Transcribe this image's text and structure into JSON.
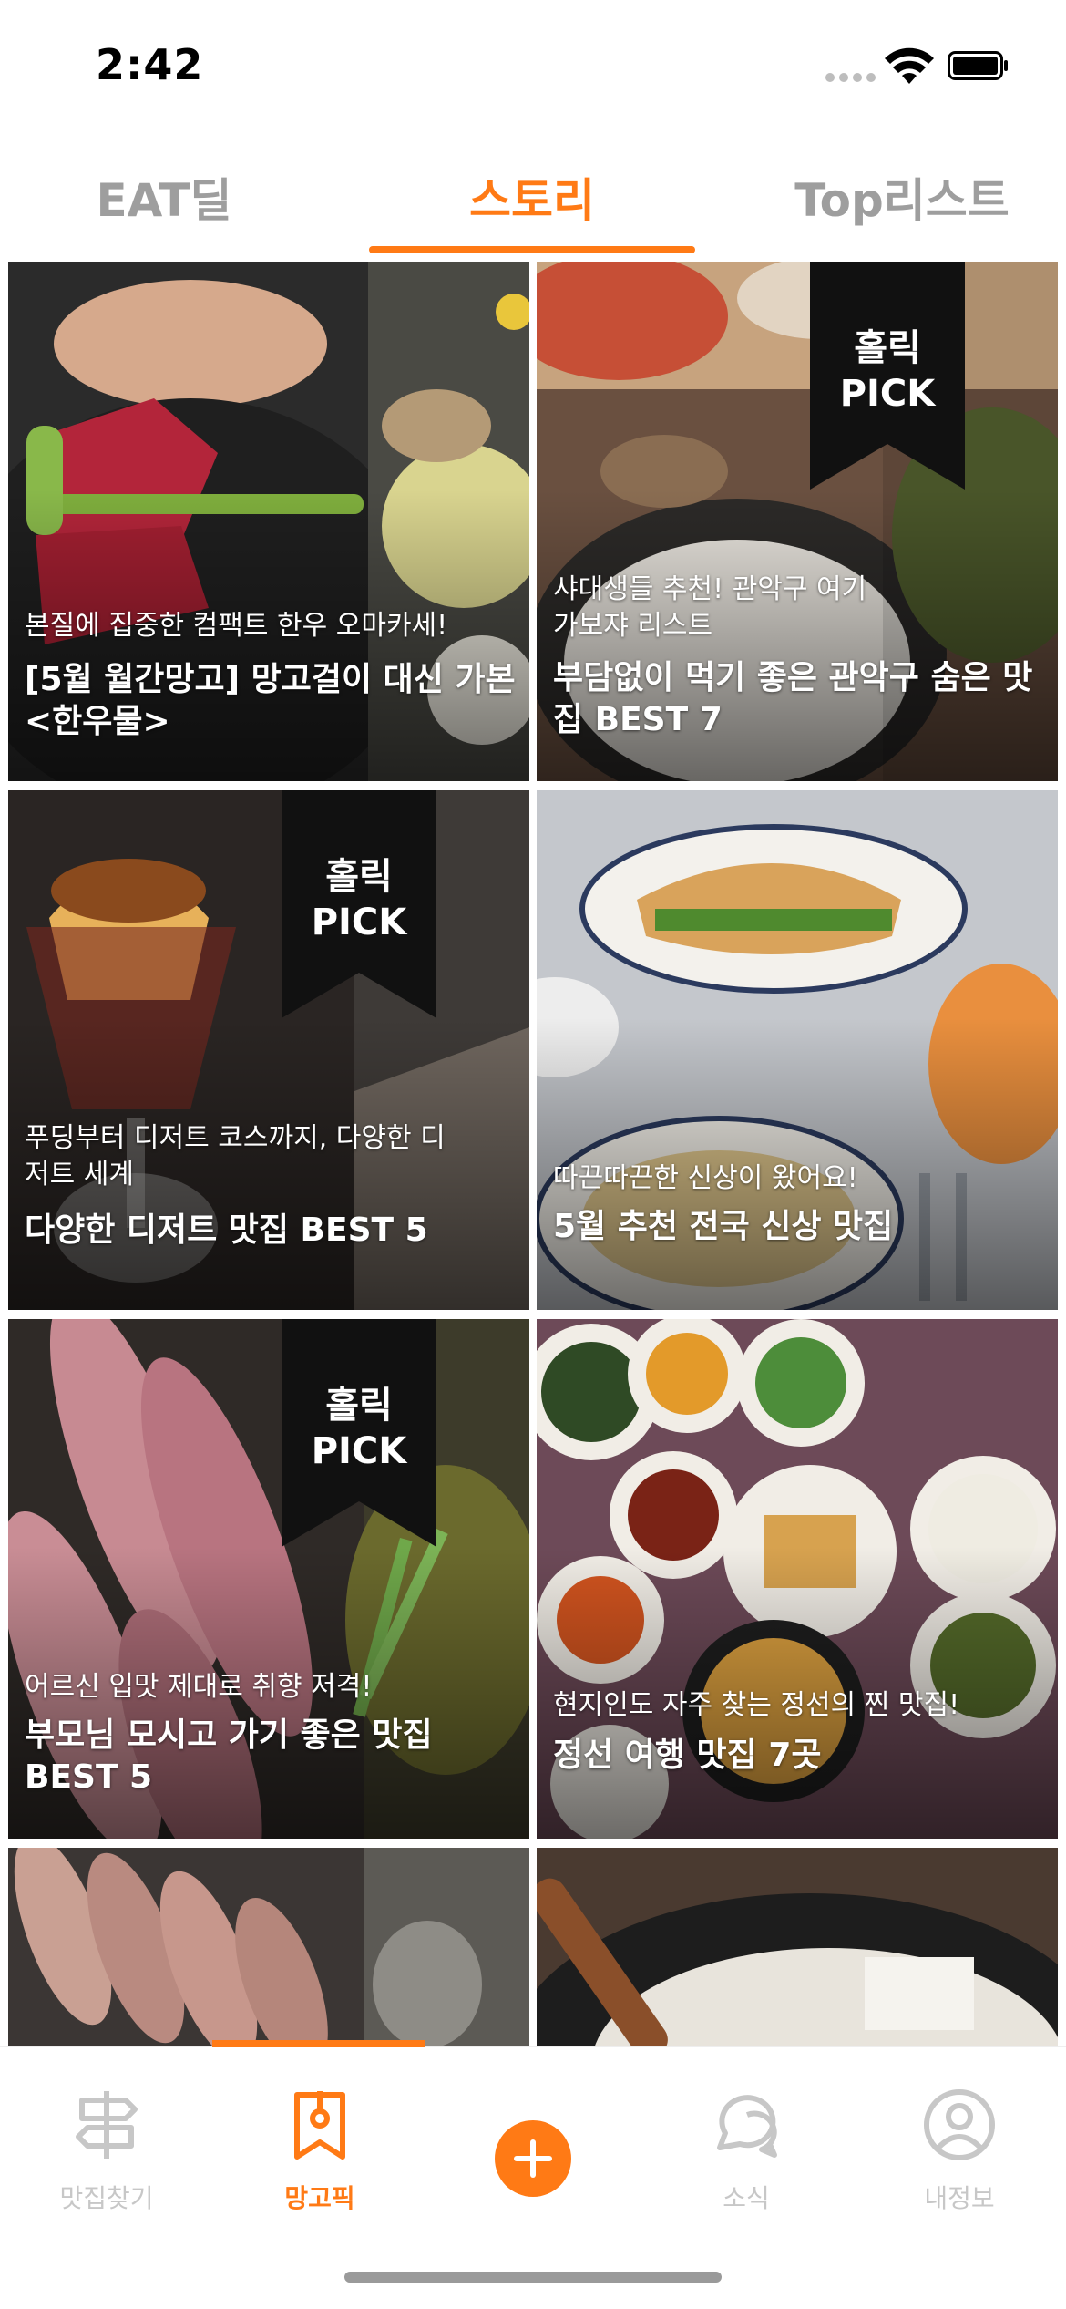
{
  "status_bar": {
    "time": "2:42",
    "icons": [
      "cellular-signal-icon",
      "wifi-icon",
      "battery-icon"
    ]
  },
  "tabs": [
    {
      "label": "EAT딜",
      "active": false
    },
    {
      "label": "스토리",
      "active": true
    },
    {
      "label": "Top리스트",
      "active": false
    }
  ],
  "accent_color": "#ff7a15",
  "cards": [
    {
      "subtitle": "본질에 집중한 컴팩트 한우 오마카세!",
      "title": "[5월 월간망고] 망고걸이 대신 가본 <한우물>",
      "badge": ""
    },
    {
      "subtitle": "샤대생들 추천! 관악구 여기 가보쟈 리스트",
      "title": "부담없이 먹기 좋은 관악구 숨은 맛집 BEST 7",
      "badge": "홀릭 PICK"
    },
    {
      "subtitle": "푸딩부터 디저트 코스까지, 다양한 디저트 세계",
      "title": "다양한 디저트 맛집 BEST 5",
      "badge": "홀릭 PICK"
    },
    {
      "subtitle": "따끈따끈한 신상이 왔어요!",
      "title": "5월 추천 전국 신상 맛집",
      "badge": ""
    },
    {
      "subtitle": "어르신 입맛 제대로 취향 저격!",
      "title": "부모님 모시고 가기 좋은 맛집 BEST 5",
      "badge": "홀릭 PICK"
    },
    {
      "subtitle": "현지인도 자주 찾는 정선의 찐 맛집!",
      "title": "정선 여행 맛집 7곳",
      "badge": ""
    }
  ],
  "badge_lines": [
    "홀릭",
    "PICK"
  ],
  "bottom_nav": [
    {
      "label": "맛집찾기",
      "icon": "signpost-icon",
      "active": false
    },
    {
      "label": "망고픽",
      "icon": "bookmark-pin-icon",
      "active": true
    },
    {
      "label": "",
      "icon": "add-icon",
      "active": false
    },
    {
      "label": "소식",
      "icon": "chat-bubble-icon",
      "active": false
    },
    {
      "label": "내정보",
      "icon": "profile-icon",
      "active": false
    }
  ]
}
